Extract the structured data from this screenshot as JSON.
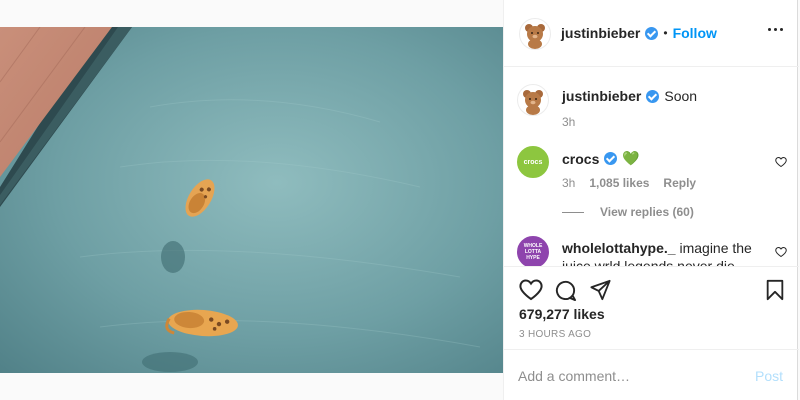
{
  "post": {
    "image_alt": "Pair of crocs floating in a pool",
    "author": {
      "username": "justinbieber",
      "verified": true,
      "follow_label": "Follow",
      "separator": "•"
    },
    "caption": {
      "username": "justinbieber",
      "text": "Soon",
      "time": "3h"
    },
    "comments": [
      {
        "username": "crocs",
        "verified": true,
        "text": "💚",
        "time": "3h",
        "likes": "1,085 likes",
        "reply_label": "Reply",
        "view_replies": "View replies (60)",
        "avatar_text": "crocs"
      },
      {
        "username": "wholelottahype._",
        "text": "imagine the juice wrld legends never die album",
        "avatar_text": [
          "WHOLE",
          "LOTTA",
          "HYPE"
        ]
      }
    ],
    "likes": "679,277 likes",
    "timestamp": "3 HOURS AGO",
    "add_comment": {
      "placeholder": "Add a comment…",
      "post_label": "Post"
    },
    "icons": [
      "heart-icon",
      "comment-icon",
      "share-icon",
      "bookmark-icon",
      "more-icon"
    ],
    "colors": {
      "follow": "#0095f6",
      "verified": "#3897f0",
      "crocs_green": "#8dc63f",
      "wholelotta_purple": "#8e44ad",
      "post_disabled": "#b2dffc"
    }
  }
}
